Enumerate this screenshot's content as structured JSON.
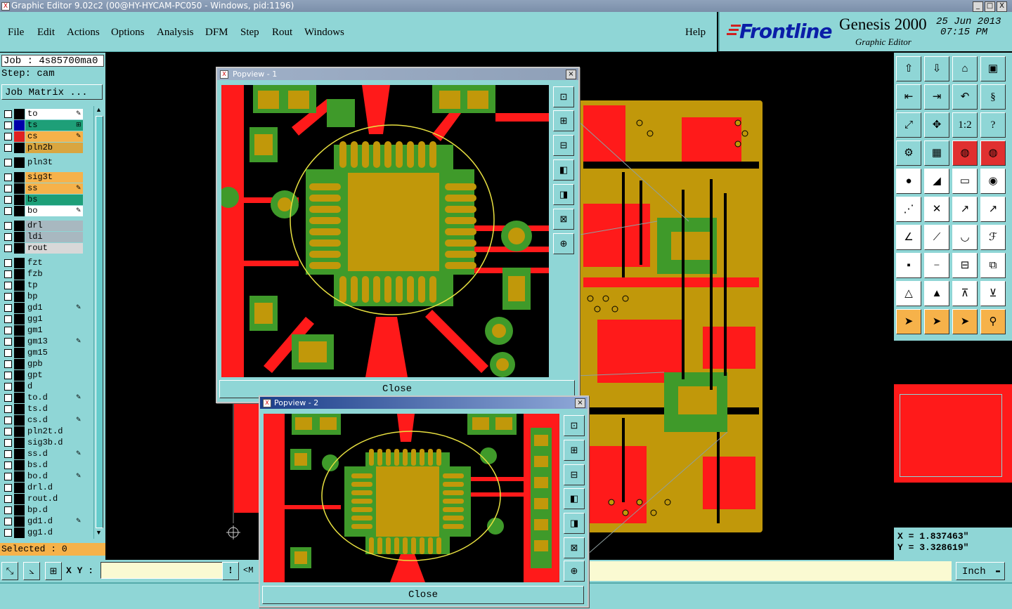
{
  "window": {
    "title": "Graphic Editor 9.02c2 (00@HY-HYCAM-PC050 - Windows, pid:1196)",
    "minimize": "_",
    "maximize": "□",
    "close": "X"
  },
  "menu": {
    "items": [
      "File",
      "Edit",
      "Actions",
      "Options",
      "Analysis",
      "DFM",
      "Step",
      "Rout",
      "Windows"
    ],
    "help": "Help"
  },
  "brand": {
    "logo": "Frontline",
    "product": "Genesis 2000",
    "subtitle": "Graphic Editor",
    "date": "25 Jun 2013",
    "time": "07:15 PM"
  },
  "job": {
    "job_label": "Job : 4s85700ma0",
    "step_label": "Step: cam",
    "matrix_button": "Job Matrix ...",
    "selected": "Selected : 0"
  },
  "layers": [
    {
      "name": "to",
      "color": "#ffffff",
      "swatch": "#000000",
      "mark": "✎"
    },
    {
      "name": "ts",
      "color": "#1e9f78",
      "swatch": "#0000aa",
      "mark": "⊞"
    },
    {
      "name": "cs",
      "color": "#f6b24a",
      "swatch": "#e02020",
      "mark": "✎"
    },
    {
      "name": "pln2b",
      "color": "#d9a640",
      "swatch": "#000000",
      "mark": ""
    },
    {
      "name": "pln3t",
      "color": "#8fd6d6",
      "swatch": "#000000",
      "mark": ""
    },
    {
      "name": "sig3t",
      "color": "#f6b24a",
      "swatch": "#000000",
      "mark": ""
    },
    {
      "name": "ss",
      "color": "#f6b24a",
      "swatch": "#000000",
      "mark": "✎"
    },
    {
      "name": "bs",
      "color": "#1e9f78",
      "swatch": "#000000",
      "mark": ""
    },
    {
      "name": "bo",
      "color": "#ffffff",
      "swatch": "#000000",
      "mark": "✎"
    },
    {
      "name": "drl",
      "color": "#a8b8c0",
      "swatch": "#000000",
      "mark": ""
    },
    {
      "name": "ldi",
      "color": "#a8b8c0",
      "swatch": "#000000",
      "mark": ""
    },
    {
      "name": "rout",
      "color": "#d8d8d8",
      "swatch": "#000000",
      "mark": ""
    },
    {
      "name": "fzt",
      "color": "#8fd6d6",
      "swatch": "#000000",
      "mark": ""
    },
    {
      "name": "fzb",
      "color": "#8fd6d6",
      "swatch": "#000000",
      "mark": ""
    },
    {
      "name": "tp",
      "color": "#8fd6d6",
      "swatch": "#000000",
      "mark": ""
    },
    {
      "name": "bp",
      "color": "#8fd6d6",
      "swatch": "#000000",
      "mark": ""
    },
    {
      "name": "gd1",
      "color": "#8fd6d6",
      "swatch": "#000000",
      "mark": "✎"
    },
    {
      "name": "gg1",
      "color": "#8fd6d6",
      "swatch": "#000000",
      "mark": ""
    },
    {
      "name": "gm1",
      "color": "#8fd6d6",
      "swatch": "#000000",
      "mark": ""
    },
    {
      "name": "gm13",
      "color": "#8fd6d6",
      "swatch": "#000000",
      "mark": "✎"
    },
    {
      "name": "gm15",
      "color": "#8fd6d6",
      "swatch": "#000000",
      "mark": ""
    },
    {
      "name": "gpb",
      "color": "#8fd6d6",
      "swatch": "#000000",
      "mark": ""
    },
    {
      "name": "gpt",
      "color": "#8fd6d6",
      "swatch": "#000000",
      "mark": ""
    },
    {
      "name": "d",
      "color": "#8fd6d6",
      "swatch": "#000000",
      "mark": ""
    },
    {
      "name": "to.d",
      "color": "#8fd6d6",
      "swatch": "#000000",
      "mark": "✎"
    },
    {
      "name": "ts.d",
      "color": "#8fd6d6",
      "swatch": "#000000",
      "mark": ""
    },
    {
      "name": "cs.d",
      "color": "#8fd6d6",
      "swatch": "#000000",
      "mark": "✎"
    },
    {
      "name": "pln2t.d",
      "color": "#8fd6d6",
      "swatch": "#000000",
      "mark": ""
    },
    {
      "name": "sig3b.d",
      "color": "#8fd6d6",
      "swatch": "#000000",
      "mark": ""
    },
    {
      "name": "ss.d",
      "color": "#8fd6d6",
      "swatch": "#000000",
      "mark": "✎"
    },
    {
      "name": "bs.d",
      "color": "#8fd6d6",
      "swatch": "#000000",
      "mark": ""
    },
    {
      "name": "bo.d",
      "color": "#8fd6d6",
      "swatch": "#000000",
      "mark": "✎"
    },
    {
      "name": "drl.d",
      "color": "#8fd6d6",
      "swatch": "#000000",
      "mark": ""
    },
    {
      "name": "rout.d",
      "color": "#8fd6d6",
      "swatch": "#000000",
      "mark": ""
    },
    {
      "name": "bp.d",
      "color": "#8fd6d6",
      "swatch": "#000000",
      "mark": ""
    },
    {
      "name": "gd1.d",
      "color": "#8fd6d6",
      "swatch": "#000000",
      "mark": "✎"
    },
    {
      "name": "gg1.d",
      "color": "#8fd6d6",
      "swatch": "#000000",
      "mark": ""
    }
  ],
  "popview1": {
    "title": "Popview - 1",
    "close": "Close"
  },
  "popview2": {
    "title": "Popview - 2",
    "close": "Close"
  },
  "coords": {
    "x": "X = 1.837463\"",
    "y": "Y = 3.328619\""
  },
  "bottom": {
    "xy_label": "X Y :",
    "xy_value": "",
    "msg_prefix": "<M",
    "units": "Inch"
  },
  "colors": {
    "copper": "#c1980a",
    "red": "#ff1a1a",
    "green": "#3f9a2a",
    "panel": "#8fd6d6",
    "orange": "#f6b24a"
  }
}
